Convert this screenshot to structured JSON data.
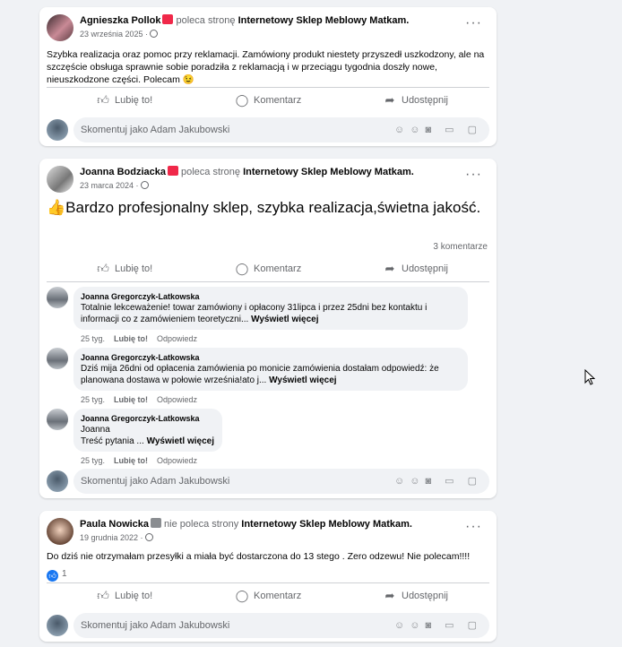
{
  "posts": [
    {
      "author": "Agnieszka Pollok",
      "verb": "poleca stronę",
      "page": "Internetowy Sklep Meblowy Matkam.",
      "date": "23 września 2025 ·",
      "text": "Szybka realizacja oraz pomoc przy reklamacji. Zamówiony produkt niestety przyszedł uszkodzony, ale na szczęście obsługa sprawnie sobie poradziła z reklamacją i w przeciągu tygodnia doszły nowe, nieuszkodzone części. Polecam 😉"
    },
    {
      "author": "Joanna Bodziacka",
      "verb": "poleca stronę",
      "page": "Internetowy Sklep Meblowy Matkam.",
      "date": "23 marca 2024 ·",
      "text": "👍Bardzo profesjonalny sklep, szybka realizacja,świetna jakość.",
      "comments_count": "3 komentarze",
      "comments": [
        {
          "name": "Joanna Gregorczyk-Latkowska",
          "text": "Totalnie lekceważenie! towar zamówiony i opłacony 31lipca i przez 25dni bez kontaktu i informacji co z zamówieniem teoretyczni...",
          "see_more": "Wyświetl więcej",
          "time": "25 tyg.",
          "like": "Lubię to!",
          "reply": "Odpowiedz"
        },
        {
          "name": "Joanna Gregorczyk-Latkowska",
          "text": "Dziś mija 26dni od opłacenia zamówienia po monicie zamówienia dostałam odpowiedź: że planowana dostawa w połowie września!ato j...",
          "see_more": "Wyświetl więcej",
          "time": "25 tyg.",
          "like": "Lubię to!",
          "reply": "Odpowiedz"
        },
        {
          "name": "Joanna Gregorczyk-Latkowska",
          "text_line1": "Joanna",
          "text": "Treść pytania ...",
          "see_more": "Wyświetl więcej",
          "time": "25 tyg.",
          "like": "Lubię to!",
          "reply": "Odpowiedz"
        }
      ]
    },
    {
      "author": "Paula Nowicka",
      "verb": "nie poleca strony",
      "page": "Internetowy Sklep Meblowy Matkam.",
      "date": "19 grudnia 2022 ·",
      "text": "Do dziś nie otrzymałam przesyłki a miała być dostarczona do 13 stego . Zero odzewu! Nie polecam!!!!",
      "likes": "1"
    }
  ],
  "actions": {
    "like": "Lubię to!",
    "comment": "Komentarz",
    "share": "Udostępnij"
  },
  "comment_placeholder": "Skomentuj jako Adam Jakubowski",
  "colors": {
    "recommend_badge": "#f02849",
    "not_recommend_badge": "#8a8d91",
    "accent": "#1877f2"
  }
}
